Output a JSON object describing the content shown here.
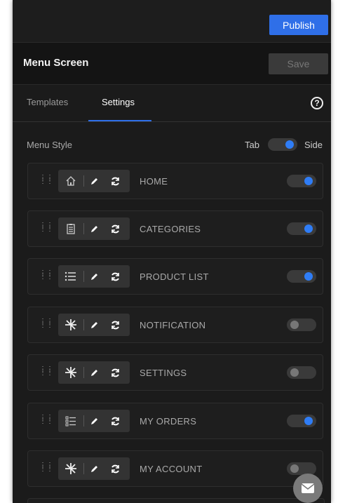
{
  "header": {
    "publish_label": "Publish"
  },
  "titlebar": {
    "title": "Menu Screen",
    "save_label": "Save"
  },
  "tabs": [
    {
      "label": "Templates",
      "active": false
    },
    {
      "label": "Settings",
      "active": true
    }
  ],
  "menu_style": {
    "label": "Menu Style",
    "option_left": "Tab",
    "option_right": "Side",
    "selected": "Side"
  },
  "items": [
    {
      "label": "HOME",
      "icon": "home-icon",
      "enabled": true
    },
    {
      "label": "CATEGORIES",
      "icon": "clipboard-icon",
      "enabled": true
    },
    {
      "label": "PRODUCT LIST",
      "icon": "list-icon",
      "enabled": true
    },
    {
      "label": "NOTIFICATION",
      "icon": "placeholder-star-icon",
      "enabled": false
    },
    {
      "label": "SETTINGS",
      "icon": "placeholder-star-icon",
      "enabled": false
    },
    {
      "label": "MY ORDERS",
      "icon": "order-list-icon",
      "enabled": true
    },
    {
      "label": "MY ACCOUNT",
      "icon": "placeholder-star-icon",
      "enabled": false
    }
  ],
  "colors": {
    "accent": "#2f6fe8",
    "panel": "#1b1b1b",
    "toggle_on": "#2f7df6"
  }
}
